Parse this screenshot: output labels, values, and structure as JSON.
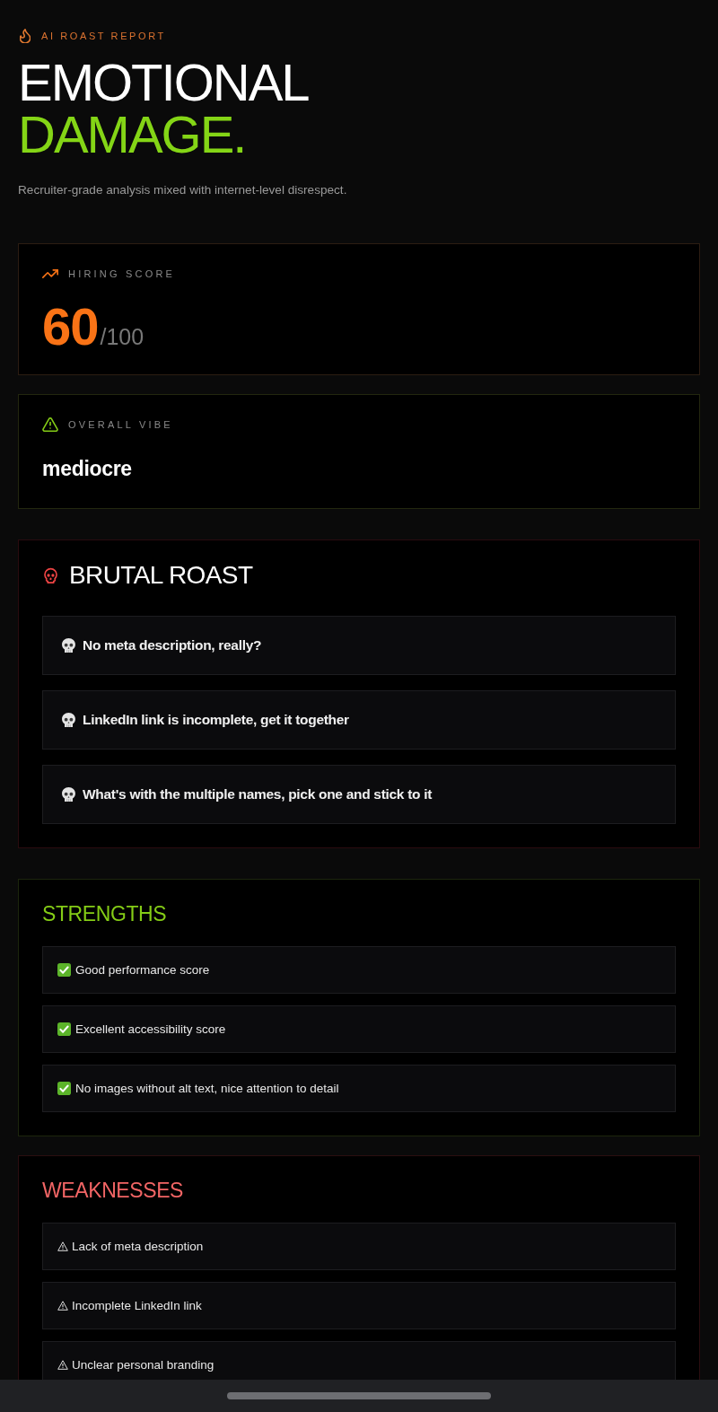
{
  "header": {
    "eyebrow": "AI ROAST REPORT",
    "title": "EMOTIONAL",
    "title_highlight": "DAMAGE.",
    "subtitle": "Recruiter-grade analysis mixed with internet-level disrespect."
  },
  "stat_cards": [
    {
      "kind": "score",
      "label": "HIRING SCORE",
      "value": "60",
      "suffix": "/100"
    },
    {
      "kind": "vibe",
      "label": "OVERALL VIBE",
      "value": "mediocre"
    }
  ],
  "sections": [
    {
      "kind": "roast",
      "heading": "BRUTAL ROAST",
      "items": [
        "No meta description, really?",
        "LinkedIn link is incomplete, get it together",
        "What's with the multiple names, pick one and stick to it"
      ]
    },
    {
      "kind": "strengths",
      "heading": "STRENGTHS",
      "items": [
        "Good performance score",
        "Excellent accessibility score",
        "No images without alt text, nice attention to detail"
      ]
    },
    {
      "kind": "weaknesses",
      "heading": "WEAKNESSES",
      "items": [
        "Lack of meta description",
        "Incomplete LinkedIn link",
        "Unclear personal branding"
      ]
    }
  ]
}
